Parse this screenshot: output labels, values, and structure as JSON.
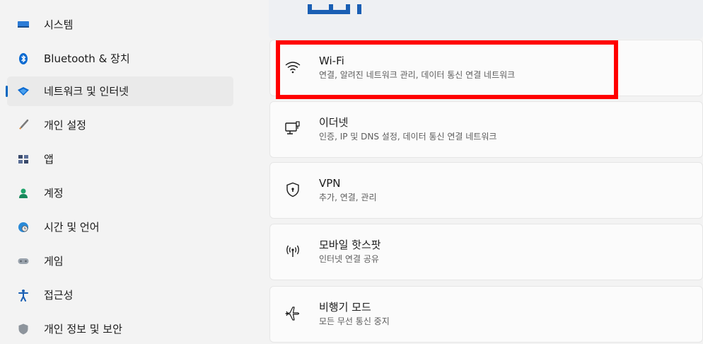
{
  "sidebar": {
    "items": [
      {
        "label": "시스템",
        "icon": "monitor-icon"
      },
      {
        "label": "Bluetooth & 장치",
        "icon": "bluetooth-icon"
      },
      {
        "label": "네트워크 및 인터넷",
        "icon": "wifi-diamond-icon",
        "selected": true
      },
      {
        "label": "개인 설정",
        "icon": "brush-icon"
      },
      {
        "label": "앱",
        "icon": "apps-icon"
      },
      {
        "label": "계정",
        "icon": "person-icon"
      },
      {
        "label": "시간 및 언어",
        "icon": "globe-clock-icon"
      },
      {
        "label": "게임",
        "icon": "gamepad-icon"
      },
      {
        "label": "접근성",
        "icon": "accessibility-icon"
      },
      {
        "label": "개인 정보 및 보안",
        "icon": "shield-icon"
      }
    ]
  },
  "main": {
    "cards": [
      {
        "title": "Wi-Fi",
        "subtitle": "연결, 알려진 네트워크 관리, 데이터 통신 연결 네트워크",
        "icon": "wifi-icon"
      },
      {
        "title": "이더넷",
        "subtitle": "인증, IP 및 DNS 설정, 데이터 통신 연결 네트워크",
        "icon": "ethernet-icon"
      },
      {
        "title": "VPN",
        "subtitle": "추가, 연결, 관리",
        "icon": "vpn-shield-icon"
      },
      {
        "title": "모바일 핫스팟",
        "subtitle": "인터넷 연결 공유",
        "icon": "hotspot-icon"
      },
      {
        "title": "비행기 모드",
        "subtitle": "모든 무선 통신 중지",
        "icon": "airplane-icon"
      }
    ]
  },
  "colors": {
    "accent": "#0067c0",
    "highlight": "#ff0000"
  }
}
